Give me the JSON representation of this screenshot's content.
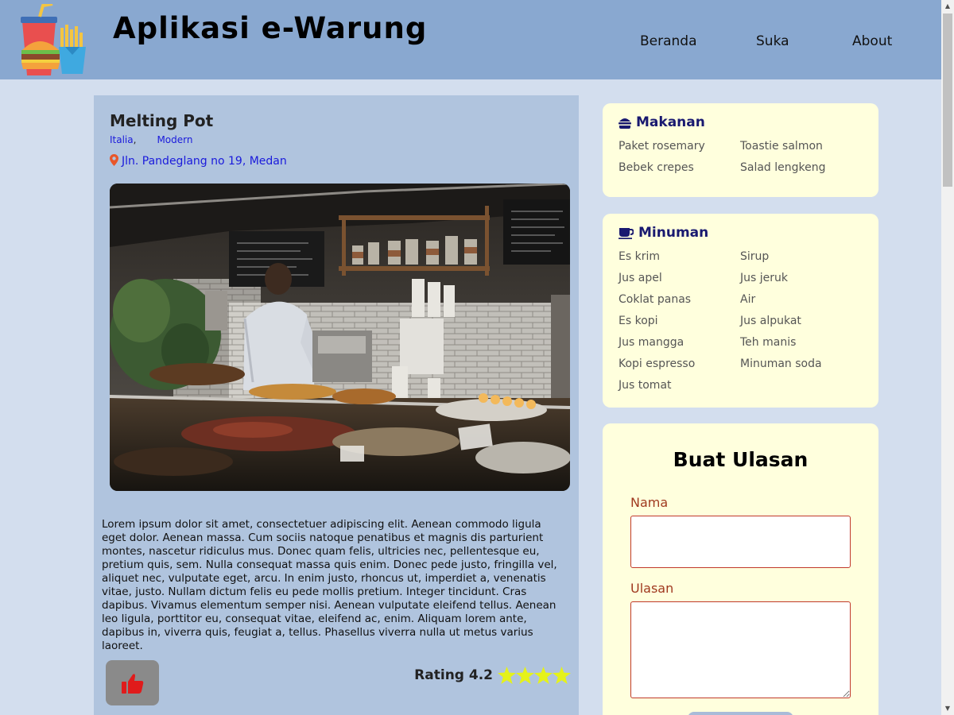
{
  "header": {
    "title": "Aplikasi e-Warung",
    "nav": [
      "Beranda",
      "Suka",
      "About"
    ]
  },
  "restaurant": {
    "name": "Melting Pot",
    "tags": [
      "Italia",
      "Modern"
    ],
    "address": "Jln. Pandeglang no 19, Medan",
    "description": "Lorem ipsum dolor sit amet, consectetuer adipiscing elit. Aenean commodo ligula eget dolor. Aenean massa. Cum sociis natoque penatibus et magnis dis parturient montes, nascetur ridiculus mus. Donec quam felis, ultricies nec, pellentesque eu, pretium quis, sem. Nulla consequat massa quis enim. Donec pede justo, fringilla vel, aliquet nec, vulputate eget, arcu. In enim justo, rhoncus ut, imperdiet a, venenatis vitae, justo. Nullam dictum felis eu pede mollis pretium. Integer tincidunt. Cras dapibus. Vivamus elementum semper nisi. Aenean vulputate eleifend tellus. Aenean leo ligula, porttitor eu, consequat vitae, eleifend ac, enim. Aliquam lorem ante, dapibus in, viverra quis, feugiat a, tellus. Phasellus viverra nulla ut metus varius laoreet.",
    "rating_label": "Rating 4.2",
    "rating_value": 4.2,
    "stars_shown": 4
  },
  "menu": {
    "food": {
      "title": "Makanan",
      "items": [
        "Paket rosemary",
        "Toastie salmon",
        "Bebek crepes",
        "Salad lengkeng"
      ]
    },
    "drinks": {
      "title": "Minuman",
      "items": [
        "Es krim",
        "Sirup",
        "Jus apel",
        "Jus jeruk",
        "Coklat panas",
        "Air",
        "Es kopi",
        "Jus alpukat",
        "Jus mangga",
        "Teh manis",
        "Kopi espresso",
        "Minuman soda",
        "Jus tomat"
      ]
    }
  },
  "review_form": {
    "title": "Buat Ulasan",
    "name_label": "Nama",
    "review_label": "Ulasan"
  },
  "colors": {
    "header_bg": "#89a8d0",
    "page_bg": "#d3deee",
    "card_bg": "#ffffdd",
    "link": "#1a1adc",
    "star": "#e5f21a",
    "like_icon": "#e01b1b"
  },
  "icons": [
    "food-logo-icon",
    "map-pin-icon",
    "burger-icon",
    "coffee-cup-icon",
    "thumbs-up-icon",
    "star-icon"
  ]
}
